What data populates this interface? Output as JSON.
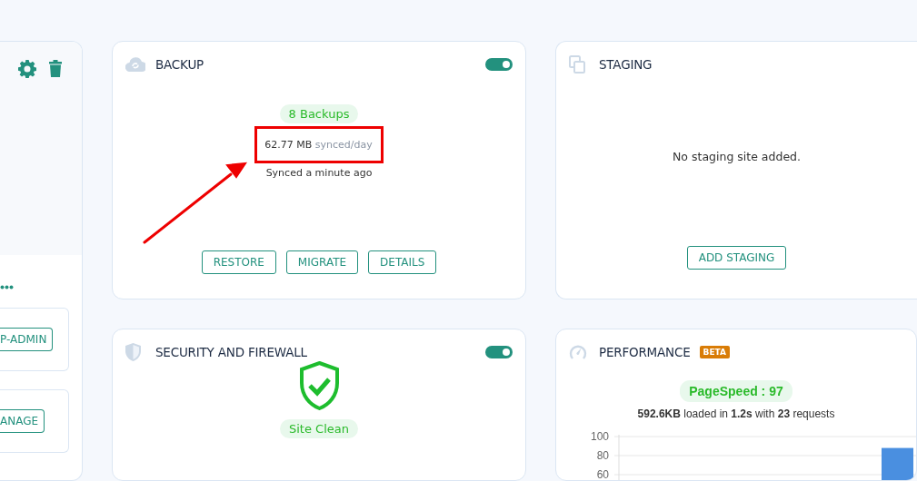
{
  "left_panel": {
    "buttons": [
      {
        "label": "P-ADMIN"
      },
      {
        "label": "ANAGE"
      }
    ]
  },
  "cards": [
    {
      "kind": "backup",
      "title": "BACKUP",
      "toggle_on": true,
      "badge": "8 Backups",
      "usage": {
        "amount": "62.77 MB",
        "unit": "synced/day",
        "highlighted": true
      },
      "sync_status": "Synced a minute ago",
      "buttons": [
        "RESTORE",
        "MIGRATE",
        "DETAILS"
      ],
      "pointer_arrow": true
    },
    {
      "kind": "staging",
      "title": "STAGING",
      "message": "No staging site added.",
      "buttons": [
        "ADD STAGING"
      ]
    },
    {
      "kind": "security",
      "title": "SECURITY AND FIREWALL",
      "toggle_on": true,
      "status": "Site Clean"
    },
    {
      "kind": "performance",
      "title": "PERFORMANCE",
      "tag": "BETA",
      "score": "PageSpeed : 97",
      "summary": "**592.6KB** loaded in **1.2s** with **23** requests",
      "chart_data": {
        "type": "bar",
        "ylim": [
          50,
          100
        ],
        "yticks": [
          60,
          80,
          100
        ],
        "values": [
          88
        ]
      }
    }
  ]
}
